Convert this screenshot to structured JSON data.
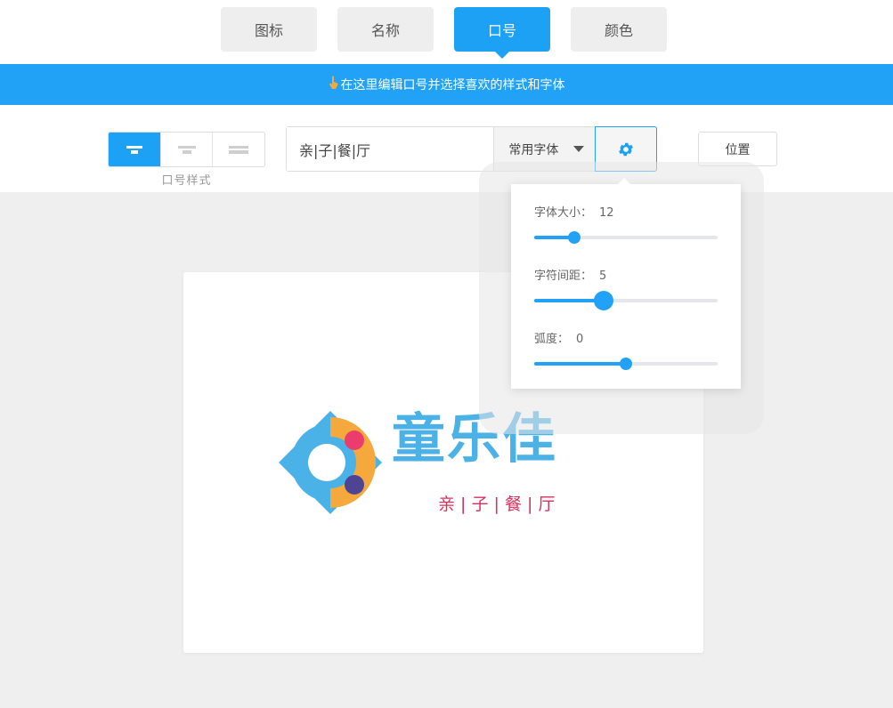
{
  "tabs": [
    {
      "label": "图标",
      "active": false
    },
    {
      "label": "名称",
      "active": false
    },
    {
      "label": "口号",
      "active": true
    },
    {
      "label": "颜色",
      "active": false
    }
  ],
  "banner": {
    "text": "在这里编辑口号并选择喜欢的样式和字体",
    "icon": "pointing-hand-icon"
  },
  "toolbar": {
    "styles_label": "口号样式",
    "slogan_value": "亲|子|餐|厅",
    "font_select": "常用字体",
    "settings_icon": "gear-icon",
    "position_label": "位置"
  },
  "settings": {
    "font_size": {
      "label": "字体大小：",
      "value": "12",
      "fraction": 0.22
    },
    "letter_spacing": {
      "label": "字符间距：",
      "value": "5",
      "fraction": 0.38
    },
    "curvature": {
      "label": "弧度：",
      "value": "0",
      "fraction": 0.5
    }
  },
  "canvas": {
    "brand_name": "童乐佳",
    "slogan": "亲 | 子 | 餐 | 厅"
  },
  "colors": {
    "accent": "#1da1f5",
    "brand_blue": "#4ab2e6",
    "slogan_red": "#d8305c",
    "logo_orange": "#f5a83b",
    "logo_pink": "#ec3c6e",
    "logo_purple": "#4d4594"
  }
}
